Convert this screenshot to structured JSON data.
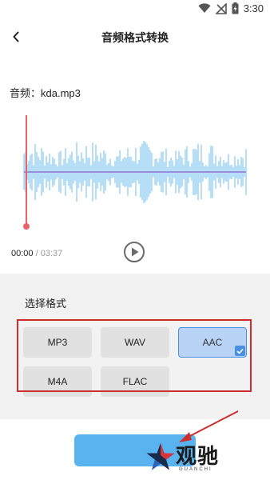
{
  "status": {
    "time": "3:30"
  },
  "header": {
    "title": "音频格式转换"
  },
  "audio": {
    "file_label": "音频：kda.mp3"
  },
  "player": {
    "current_time": "00:00",
    "separator": " / ",
    "total_time": "03:37"
  },
  "format_panel": {
    "title": "选择格式",
    "formats": [
      "MP3",
      "WAV",
      "AAC",
      "M4A",
      "FLAC"
    ],
    "selected": "AAC"
  },
  "watermark": {
    "brand": "观驰",
    "sub": "GUANCHI"
  },
  "colors": {
    "waveform": "#8fcdf0",
    "centerline": "#9a8ee0",
    "playhead": "#e8636b",
    "accent": "#4a90e2",
    "convert_button": "#58b3ef",
    "annotation": "#cc2f2f"
  },
  "icons": {
    "status": [
      "wifi-icon",
      "no-signal-icon",
      "battery-icon"
    ],
    "back": "back-arrow-icon",
    "play": "play-icon",
    "check": "check-icon"
  }
}
